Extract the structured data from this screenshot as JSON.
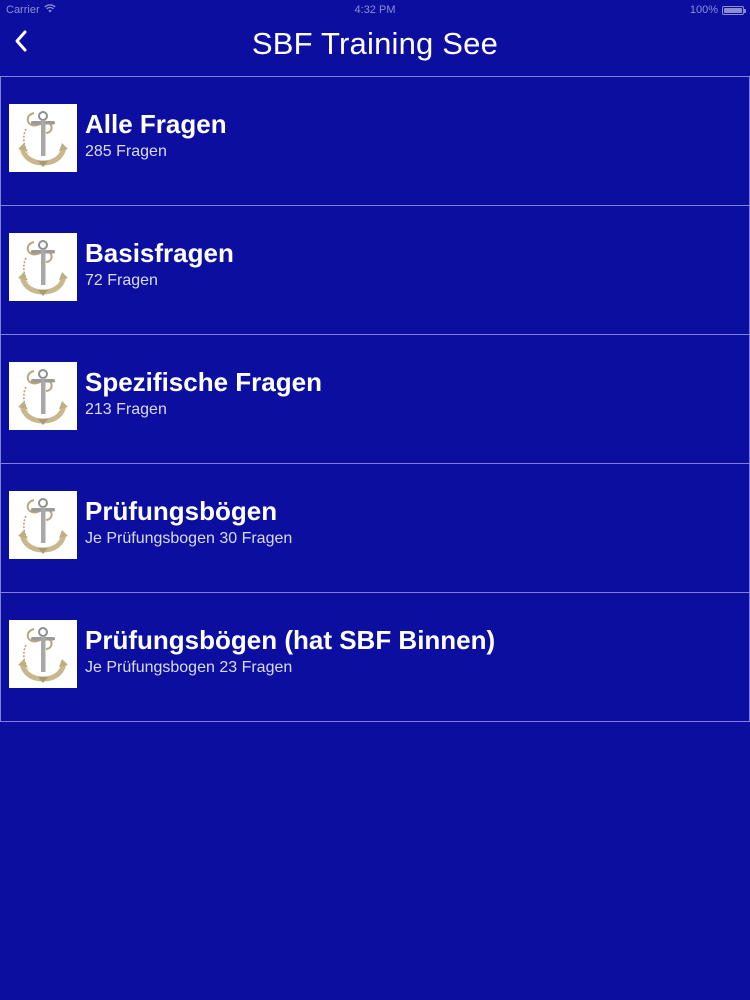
{
  "status_bar": {
    "carrier": "Carrier",
    "time": "4:32 PM",
    "battery_text": "100%",
    "battery_level": 1.0
  },
  "nav": {
    "title": "SBF Training See",
    "back_icon": "chevron-left-icon"
  },
  "list": {
    "items": [
      {
        "title": "Alle Fragen",
        "subtitle": "285 Fragen",
        "icon": "anchor-icon"
      },
      {
        "title": "Basisfragen",
        "subtitle": "72 Fragen",
        "icon": "anchor-icon"
      },
      {
        "title": "Spezifische Fragen",
        "subtitle": "213 Fragen",
        "icon": "anchor-icon"
      },
      {
        "title": "Prüfungsbögen",
        "subtitle": "Je Prüfungsbogen 30 Fragen",
        "icon": "anchor-icon"
      },
      {
        "title": "Prüfungsbögen (hat SBF Binnen)",
        "subtitle": "Je Prüfungsbogen 23 Fragen",
        "icon": "anchor-icon"
      }
    ]
  },
  "colors": {
    "background": "#0b0e9f",
    "separator": "#7d82d6",
    "text": "#ffffff"
  }
}
